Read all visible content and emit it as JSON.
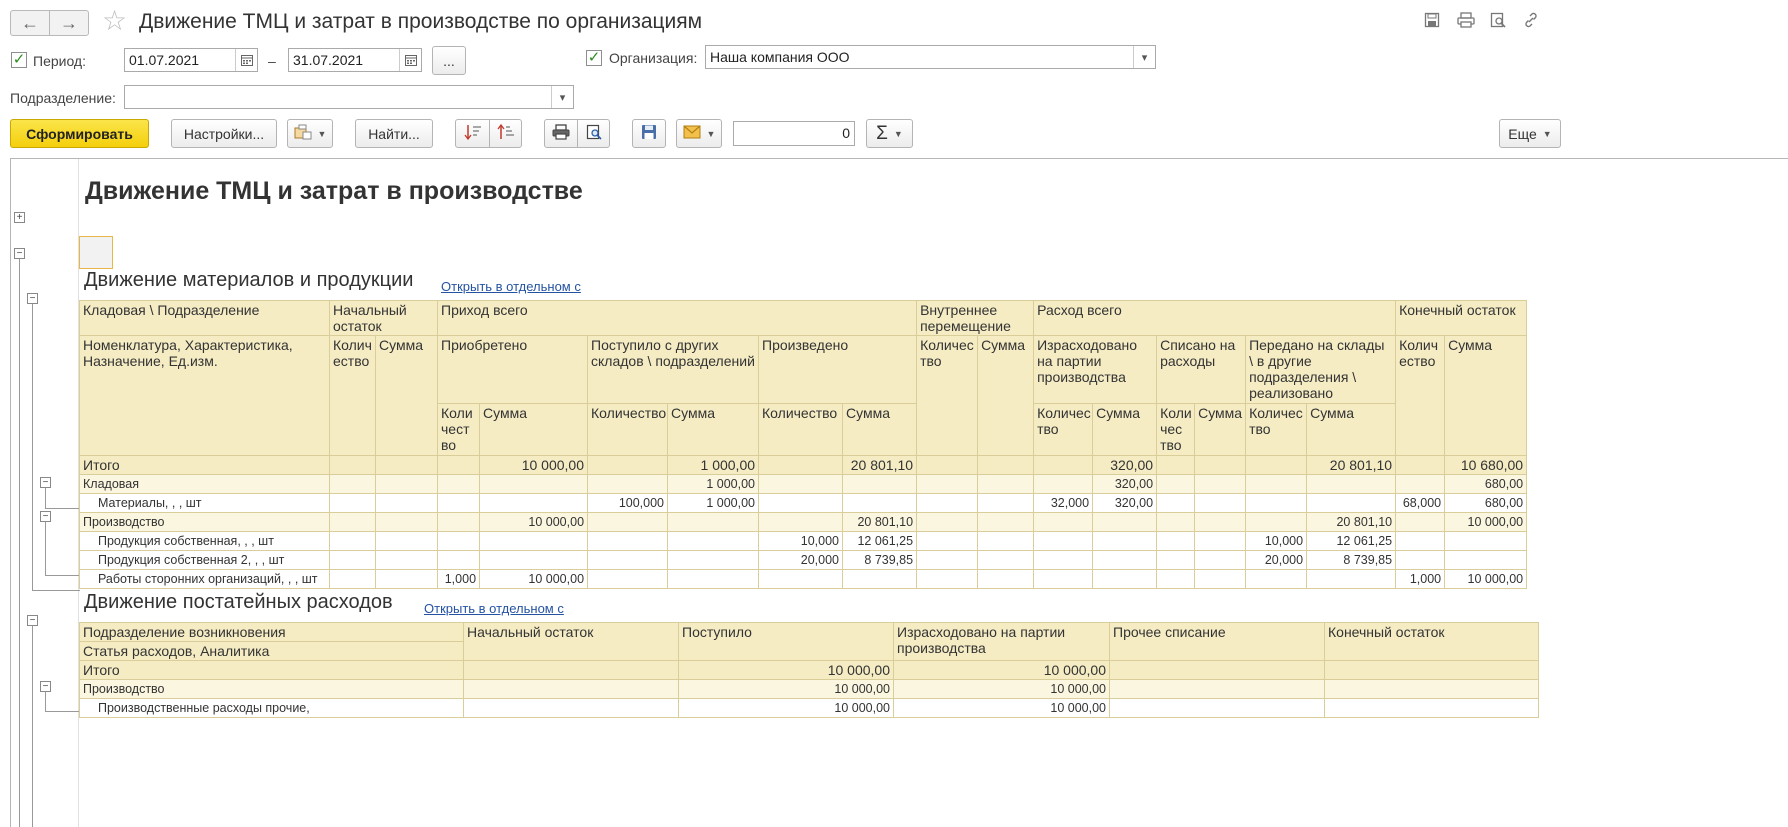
{
  "window": {
    "title": "Движение ТМЦ и затрат в производстве по организациям"
  },
  "icons": {
    "back": "arrow-left-icon",
    "forward": "arrow-right-icon",
    "favorite": "star-icon",
    "save": "floppy-icon",
    "print": "printer-icon",
    "preview": "preview-icon",
    "link": "link-icon"
  },
  "filters": {
    "period_label": "Период:",
    "date_from": "01.07.2021",
    "dash": "–",
    "date_to": "31.07.2021",
    "more": "...",
    "org_label": "Организация:",
    "org_value": "Наша компания ООО",
    "division_label": "Подразделение:",
    "division_value": ""
  },
  "toolbar": {
    "generate": "Сформировать",
    "settings": "Настройки...",
    "find": "Найти...",
    "counter": "0",
    "sigma": "Σ",
    "more": "Еще"
  },
  "report": {
    "title": "Движение ТМЦ и затрат в производстве",
    "materials": {
      "title": "Движение материалов и продукции",
      "link": "Открыть в отдельном с",
      "h": {
        "store_div": "Кладовая \\ Подразделение",
        "opening": "Начальный остаток",
        "income_total": "Приход всего",
        "internal": "Внутреннее перемещение",
        "outgo_total": "Расход всего",
        "closing": "Конечный остаток",
        "nomenclature": "Номенклатура, Характеристика, Назначение, Ед.изм.",
        "qty_short": "Колич ество",
        "sum": "Сумма",
        "acquired": "Приобретено",
        "received_other": "Поступило с других складов \\ подразделений",
        "produced": "Произведено",
        "qty_int": "Количес тво",
        "consumed": "Израсходовано на партии производства",
        "written_off": "Списано на расходы",
        "transferred": "Передано на склады \\ в другие подразделения \\ реализовано",
        "qty_acq": "Коли чест во",
        "qty": "Количество",
        "qty_cons": "Количес тво",
        "qty_wo": "Коли чес тво",
        "qty_tr": "Количес тво"
      },
      "rows": [
        {
          "name": "Итого",
          "acq_sum": "10 000,00",
          "rec_sum": "1 000,00",
          "prod_sum": "20 801,10",
          "cons_sum": "320,00",
          "tr_sum": "20 801,10",
          "close_sum": "10 680,00"
        },
        {
          "name": "Кладовая",
          "rec_sum": "1 000,00",
          "cons_sum": "320,00",
          "close_sum": "680,00"
        },
        {
          "name": "Материалы, , , шт",
          "rec_qty": "100,000",
          "rec_sum": "1 000,00",
          "cons_qty": "32,000",
          "cons_sum": "320,00",
          "close_qty": "68,000",
          "close_sum": "680,00"
        },
        {
          "name": "Производство",
          "acq_sum": "10 000,00",
          "prod_sum": "20 801,10",
          "tr_sum": "20 801,10",
          "close_sum": "10 000,00"
        },
        {
          "name": "Продукция собственная, , , шт",
          "prod_qty": "10,000",
          "prod_sum": "12 061,25",
          "tr_qty": "10,000",
          "tr_sum": "12 061,25"
        },
        {
          "name": "Продукция собственная 2, , , шт",
          "prod_qty": "20,000",
          "prod_sum": "8 739,85",
          "tr_qty": "20,000",
          "tr_sum": "8 739,85"
        },
        {
          "name": "Работы сторонних организаций, , , шт",
          "acq_qty": "1,000",
          "acq_sum": "10 000,00",
          "close_qty": "1,000",
          "close_sum": "10 000,00"
        }
      ]
    },
    "expenses": {
      "title": "Движение постатейных расходов",
      "link": "Открыть в отдельном с",
      "h": {
        "division": "Подразделение возникновения",
        "article": "Статья расходов, Аналитика",
        "opening": "Начальный остаток",
        "received": "Поступило",
        "consumed": "Израсходовано на партии производства",
        "other": "Прочее списание",
        "closing": "Конечный остаток"
      },
      "rows": [
        {
          "name": "Итого",
          "received": "10 000,00",
          "consumed": "10 000,00"
        },
        {
          "name": "Производство",
          "received": "10 000,00",
          "consumed": "10 000,00"
        },
        {
          "name": "Производственные расходы прочие,",
          "received": "10 000,00",
          "consumed": "10 000,00"
        }
      ]
    }
  }
}
